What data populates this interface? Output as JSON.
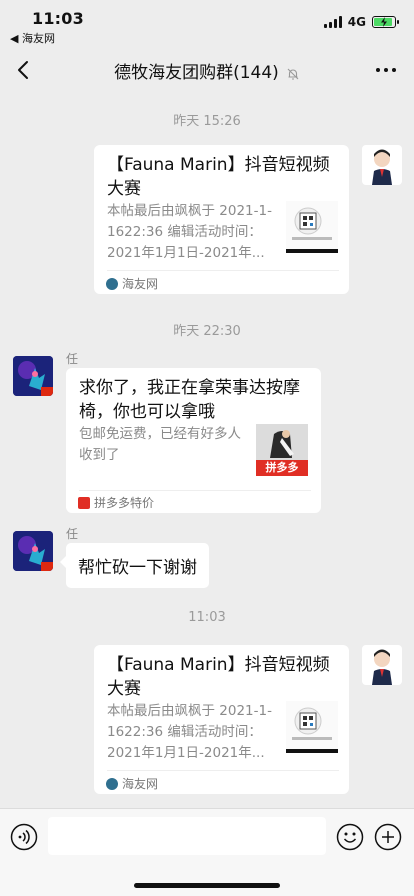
{
  "status": {
    "time": "11:03",
    "back_app": "◀ 海友网",
    "network": "4G"
  },
  "nav": {
    "title": "德牧海友团购群(144)"
  },
  "messages": [
    {
      "timestamp": "昨天 15:26",
      "card_title": "【Fauna Marin】抖音短视频大赛",
      "card_desc": "本帖最后由飒枫于 2021-1-1622:36 编辑活动时间：2021年1月1日-2021年...",
      "card_source": "海友网"
    },
    {
      "timestamp": "昨天 22:30",
      "sender": "任",
      "card_title": "求你了，我正在拿荣事达按摩椅，你也可以拿哦",
      "card_desc": "包邮免运费，已经有好多人收到了",
      "thumb_label": "拼多多",
      "card_source": "拼多多特价"
    },
    {
      "sender": "任",
      "text": "帮忙砍一下谢谢"
    },
    {
      "timestamp": "11:03",
      "card_title": "【Fauna Marin】抖音短视频大赛",
      "card_desc": "本帖最后由飒枫于 2021-1-1622:36 编辑活动时间：2021年1月1日-2021年...",
      "card_source": "海友网"
    }
  ],
  "icons": {
    "back": "chevron-left-icon",
    "mute": "bell-slash-icon",
    "more": "ellipsis-icon",
    "voice": "voice-icon",
    "emoji": "emoji-icon",
    "plus": "plus-icon"
  },
  "colors": {
    "background": "#ededed",
    "bubble": "#ffffff",
    "pdd_red": "#e02e24",
    "battery_green": "#4cd964"
  }
}
